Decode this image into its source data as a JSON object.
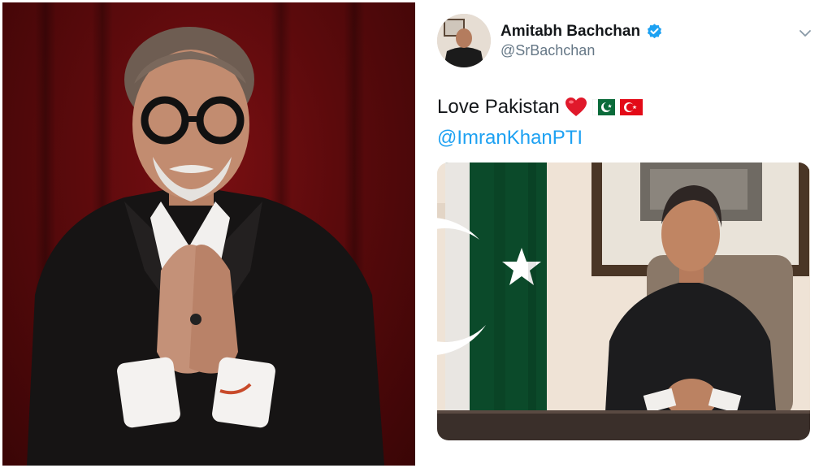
{
  "tweet": {
    "display_name": "Amitabh Bachchan",
    "verified": true,
    "handle": "@SrBachchan",
    "text": "Love Pakistan",
    "emojis": [
      "red-heart",
      "flag-pakistan",
      "flag-turkey"
    ],
    "mention": "@ImranKhanPTI",
    "menu_icon": "chevron-down-icon"
  },
  "colors": {
    "name_text": "#14171a",
    "handle_text": "#657786",
    "link_blue": "#1da1f2",
    "verified_blue": "#1da1f2",
    "curtain_red": "#5b0a0c",
    "flag_green": "#0b4a2a"
  }
}
